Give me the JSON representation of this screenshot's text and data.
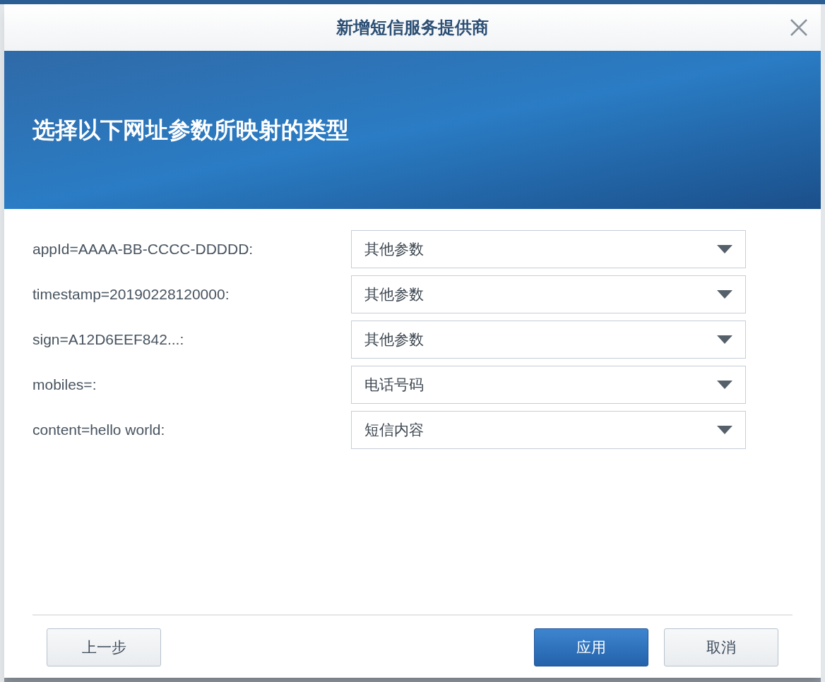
{
  "window": {
    "title": "新增短信服务提供商"
  },
  "banner": {
    "heading": "选择以下网址参数所映射的类型"
  },
  "fields": [
    {
      "label": "appId=AAAA-BB-CCCC-DDDDD:",
      "value": "其他参数"
    },
    {
      "label": "timestamp=20190228120000:",
      "value": "其他参数"
    },
    {
      "label": "sign=A12D6EEF842...:",
      "value": "其他参数"
    },
    {
      "label": "mobiles=:",
      "value": "电话号码"
    },
    {
      "label": "content=hello world:",
      "value": "短信内容"
    }
  ],
  "buttons": [
    {
      "label": "上一步",
      "kind": "secondary"
    },
    {
      "label": "应用",
      "kind": "primary"
    },
    {
      "label": "取消",
      "kind": "secondary"
    }
  ]
}
